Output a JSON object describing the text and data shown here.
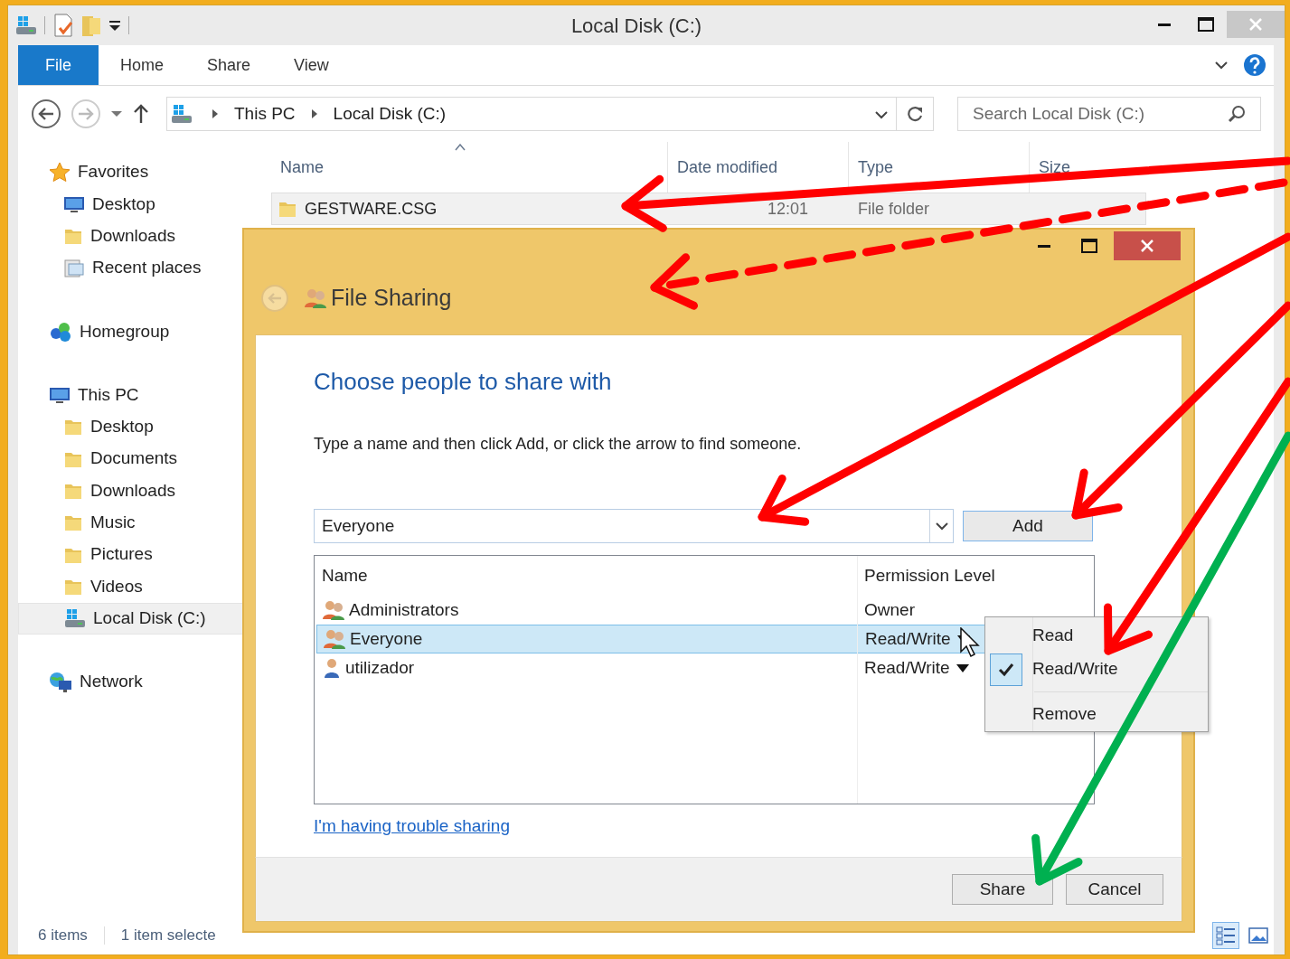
{
  "window": {
    "title": "Local Disk (C:)"
  },
  "ribbon": {
    "tabs": [
      {
        "label": "File",
        "selected": true
      },
      {
        "label": "Home",
        "selected": false
      },
      {
        "label": "Share",
        "selected": false
      },
      {
        "label": "View",
        "selected": false
      }
    ]
  },
  "address_bar": {
    "path": [
      "This PC",
      "Local Disk (C:)"
    ]
  },
  "search": {
    "placeholder": "Search Local Disk (C:)"
  },
  "sidebar": {
    "groups": [
      {
        "label": "Favorites",
        "children": [
          {
            "label": "Desktop",
            "selected": false
          },
          {
            "label": "Downloads",
            "selected": false
          },
          {
            "label": "Recent places",
            "selected": false
          }
        ]
      },
      {
        "label": "Homegroup"
      },
      {
        "label": "This PC",
        "children": [
          {
            "label": "Desktop",
            "selected": false
          },
          {
            "label": "Documents",
            "selected": false
          },
          {
            "label": "Downloads",
            "selected": false
          },
          {
            "label": "Music",
            "selected": false
          },
          {
            "label": "Pictures",
            "selected": false
          },
          {
            "label": "Videos",
            "selected": false
          },
          {
            "label": "Local Disk (C:)",
            "selected": true
          }
        ]
      },
      {
        "label": "Network"
      }
    ]
  },
  "file_list": {
    "columns": [
      "Name",
      "Date modified",
      "Type",
      "Size"
    ],
    "rows": [
      {
        "name": "GESTWARE.CSG",
        "date_modified": "12:01",
        "type": "File folder",
        "selected": true
      }
    ]
  },
  "status_bar": {
    "item_count": "6 items",
    "selection": "1 item selecte",
    "views": [
      {
        "kind": "details",
        "selected": true
      },
      {
        "kind": "thumbnails",
        "selected": false
      }
    ]
  },
  "dialog": {
    "title": "File Sharing",
    "heading": "Choose people to share with",
    "instruction": "Type a name and then click Add, or click the arrow to find someone.",
    "name_input": {
      "value": "Everyone"
    },
    "add_button": "Add",
    "table": {
      "columns": [
        "Name",
        "Permission Level"
      ],
      "rows": [
        {
          "name": "Administrators",
          "permission": "Owner",
          "kind": "group",
          "editable": false,
          "selected": false
        },
        {
          "name": "Everyone",
          "permission": "Read/Write",
          "kind": "group",
          "editable": true,
          "selected": true
        },
        {
          "name": "utilizador",
          "permission": "Read/Write",
          "kind": "user",
          "editable": true,
          "selected": false
        }
      ]
    },
    "menu": {
      "items": [
        {
          "label": "Read",
          "kind": "option",
          "checked": false
        },
        {
          "label": "Read/Write",
          "kind": "option",
          "checked": true
        },
        {
          "label": "Remove",
          "kind": "action",
          "checked": false
        }
      ]
    },
    "help_link": "I'm having trouble sharing",
    "buttons": [
      "Share",
      "Cancel"
    ]
  },
  "annotations": [
    {
      "kind": "solid",
      "color": "#ff0000"
    },
    {
      "kind": "dashed",
      "color": "#ff0000"
    },
    {
      "kind": "solid",
      "color": "#ff0000"
    },
    {
      "kind": "solid",
      "color": "#ff0000"
    },
    {
      "kind": "solid",
      "color": "#ff0000"
    },
    {
      "kind": "solid",
      "color": "#00b050"
    }
  ]
}
